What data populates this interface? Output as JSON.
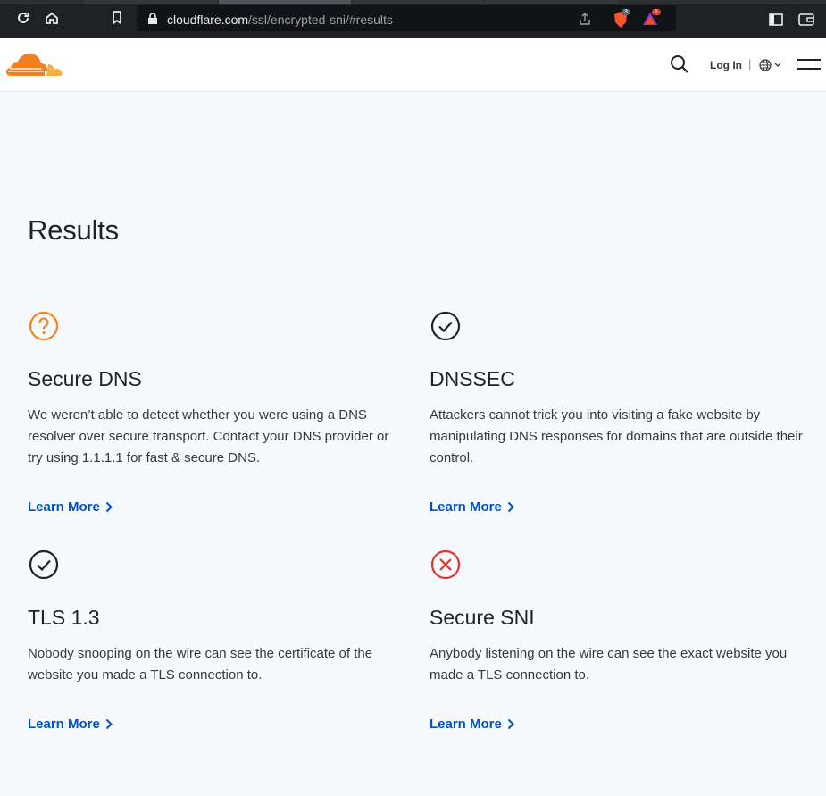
{
  "browser": {
    "url_host": "cloudflare.com",
    "url_path": "/ssl/encrypted-sni/#results",
    "brave_badge": "3",
    "rewards_badge": "1"
  },
  "header": {
    "login_label": "Log In",
    "separator": "|"
  },
  "main": {
    "title": "Results",
    "cards": [
      {
        "status": "unknown",
        "title": "Secure DNS",
        "description": "We weren’t able to detect whether you were using a DNS resolver over secure transport. Contact your DNS provider or try using 1.1.1.1 for fast & secure DNS.",
        "link": "Learn More"
      },
      {
        "status": "pass",
        "title": "DNSSEC",
        "description": "Attackers cannot trick you into visiting a fake website by manipulating DNS responses for domains that are outside their control.",
        "link": "Learn More"
      },
      {
        "status": "pass",
        "title": "TLS 1.3",
        "description": "Nobody snooping on the wire can see the certificate of the website you made a TLS connection to.",
        "link": "Learn More"
      },
      {
        "status": "fail",
        "title": "Secure SNI",
        "description": "Anybody listening on the wire can see the exact website you made a TLS connection to.",
        "link": "Learn More"
      }
    ]
  },
  "colors": {
    "unknown": "#f6821f",
    "pass": "#222222",
    "fail": "#e0352b",
    "link": "#0051c3",
    "brand": "#f38020"
  }
}
